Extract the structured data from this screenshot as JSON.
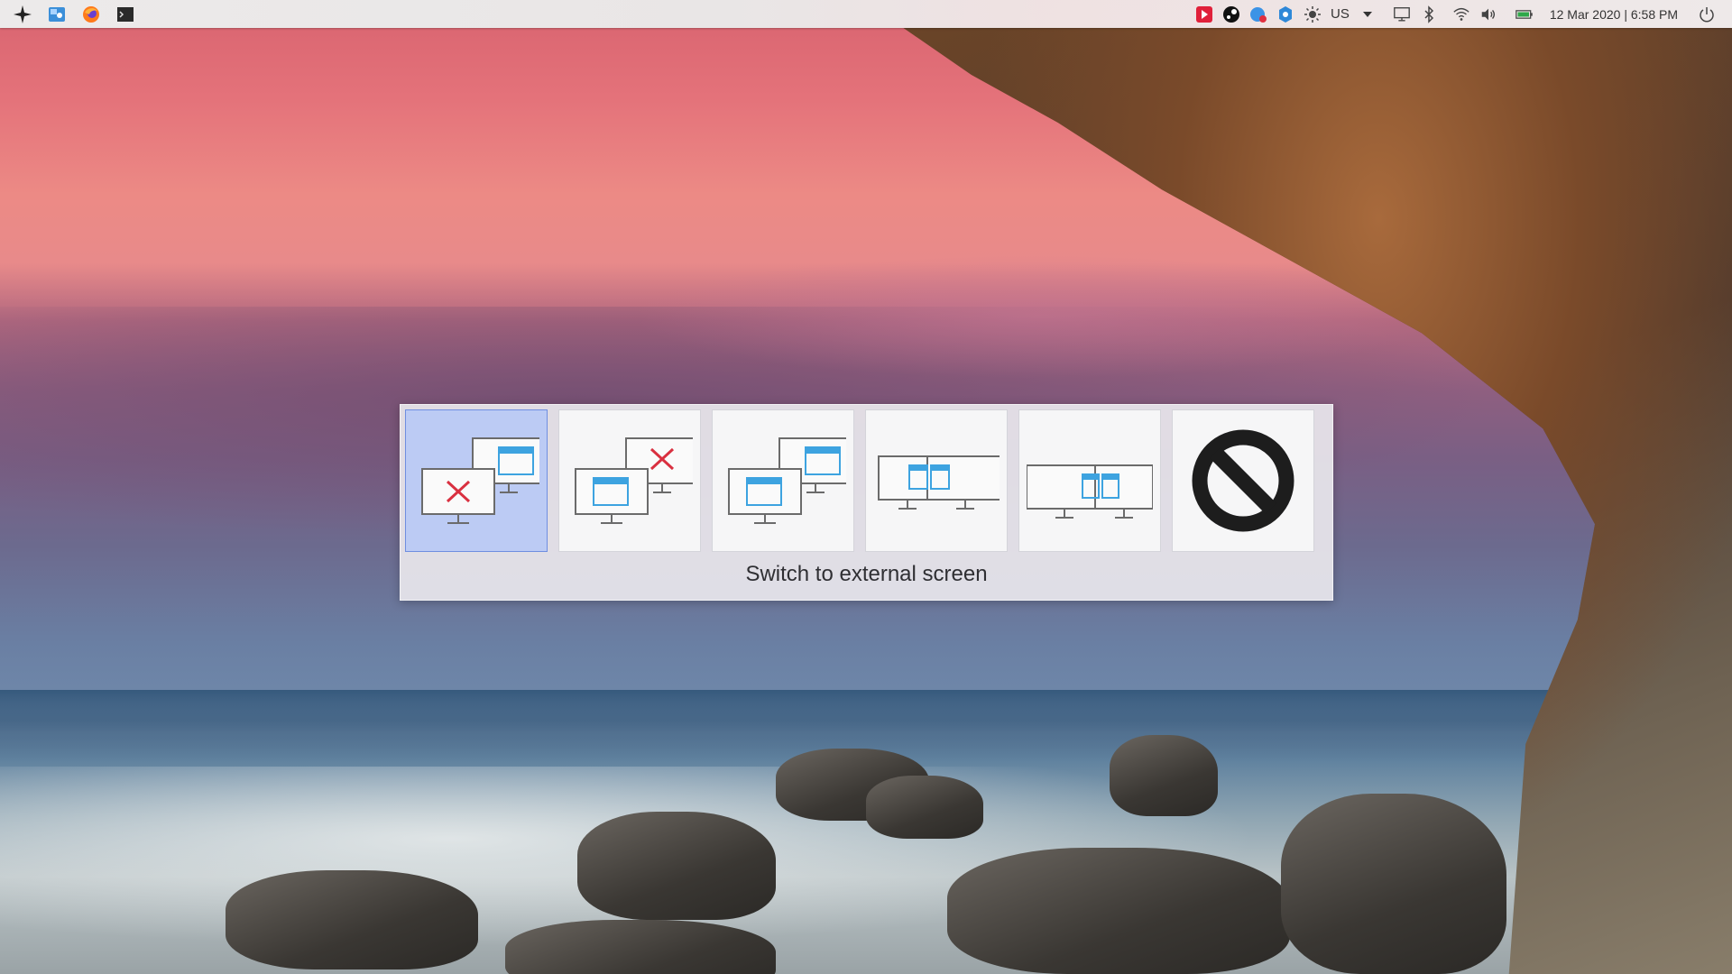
{
  "panel": {
    "launchers": [
      {
        "name": "app-launcher-icon",
        "color": "#222222"
      },
      {
        "name": "file-manager-icon",
        "color": "#3b8fd9"
      },
      {
        "name": "firefox-icon",
        "color": "#ff7a1a"
      },
      {
        "name": "terminal-icon",
        "color": "#2a2a2a"
      }
    ],
    "tray": {
      "keyboard_layout": "US",
      "clock": "12 Mar 2020 | 6:58 PM"
    }
  },
  "osd": {
    "selected_index": 0,
    "accent_color": "#bccbf4",
    "options": [
      {
        "icon": "switch-to-external-screen-icon"
      },
      {
        "icon": "switch-to-laptop-screen-icon"
      },
      {
        "icon": "clone-screens-icon"
      },
      {
        "icon": "extend-left-icon"
      },
      {
        "icon": "extend-right-icon"
      },
      {
        "icon": "no-action-icon"
      }
    ],
    "label": "Switch to external screen"
  }
}
